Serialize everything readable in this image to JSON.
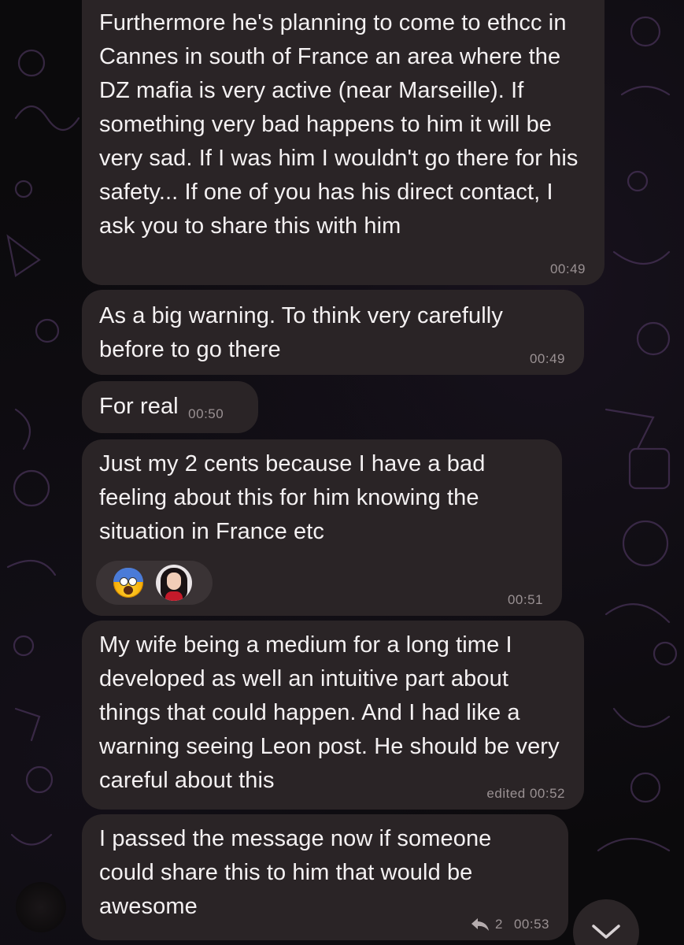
{
  "messages": [
    {
      "text": "Furthermore he's planning to come to ethcc in Cannes in south of France an area where the DZ mafia is very active (near Marseille). If something very bad happens to him it will be very sad. If I was him I wouldn't go there for his safety... If one of you has his direct contact, I ask you to share this with him",
      "time": "00:49"
    },
    {
      "text": "As a big warning. To think very carefully before to go there",
      "time": "00:49"
    },
    {
      "text": "For real",
      "time": "00:50"
    },
    {
      "text": "Just my 2 cents because I have a bad feeling about this for him knowing the situation in France etc",
      "time": "00:51",
      "reactions": [
        "fearful-face-emoji",
        "reactor-avatar"
      ]
    },
    {
      "text": "My wife being a medium for a long time I developed as well an intuitive part about things that could happen. And I had like a warning seeing Leon post. He should be very careful about this",
      "time": "edited 00:52"
    },
    {
      "text": "I passed the message now if someone could share this to him that would be awesome",
      "time": "00:53",
      "reply_count": "2"
    }
  ],
  "icons": {
    "reply": "reply-arrow-icon",
    "scroll_down": "chevron-down-icon"
  },
  "colors": {
    "background": "#0b0a0c",
    "bubble": "#2a2426",
    "text": "#f4f1f2",
    "meta": "#9a9193",
    "doodle": "#5a3f6e"
  }
}
